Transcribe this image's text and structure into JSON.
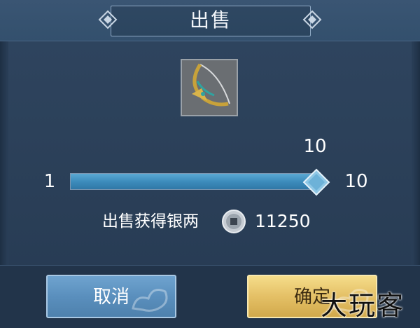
{
  "dialog": {
    "title": "出售"
  },
  "item": {
    "icon": "bow-weapon-icon"
  },
  "quantity": {
    "selected": 10,
    "min": 1,
    "max": 10,
    "selected_label": "10",
    "min_label": "1",
    "max_label": "10"
  },
  "earnings": {
    "label": "出售获得银两",
    "currency_icon": "silver-coin-icon",
    "value": "11250"
  },
  "buttons": {
    "cancel_label": "取消",
    "confirm_label": "确定"
  },
  "watermark": {
    "text": "大玩客"
  },
  "colors": {
    "panel_bg": "#2c415a",
    "slider_fill": "#3d8cbc",
    "cancel_button": "#5a8fbd",
    "confirm_button": "#e4c066"
  }
}
